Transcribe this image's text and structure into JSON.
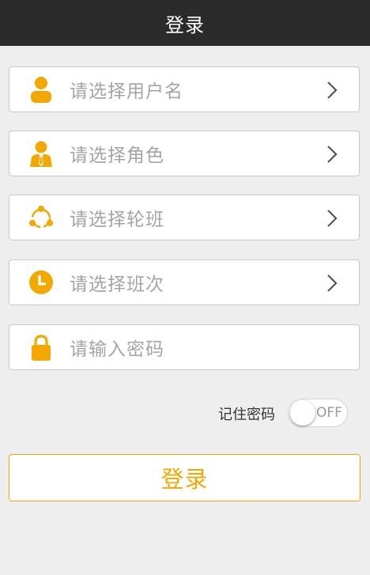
{
  "header": {
    "title": "登录"
  },
  "form": {
    "username": {
      "placeholder": "请选择用户名",
      "icon": "user-icon"
    },
    "role": {
      "placeholder": "请选择角色",
      "icon": "role-user-tie-icon"
    },
    "shift_rotation": {
      "placeholder": "请选择轮班",
      "icon": "rotation-cycle-icon"
    },
    "shift": {
      "placeholder": "请选择班次",
      "icon": "clock-icon"
    },
    "password": {
      "placeholder": "请输入密码",
      "icon": "lock-icon"
    }
  },
  "remember": {
    "label": "记住密码",
    "toggle_state": "OFF",
    "on": false
  },
  "login_button": {
    "label": "登录"
  },
  "colors": {
    "accent": "#f2a800",
    "titlebar": "#2b2b2b",
    "background": "#eeeeee"
  }
}
